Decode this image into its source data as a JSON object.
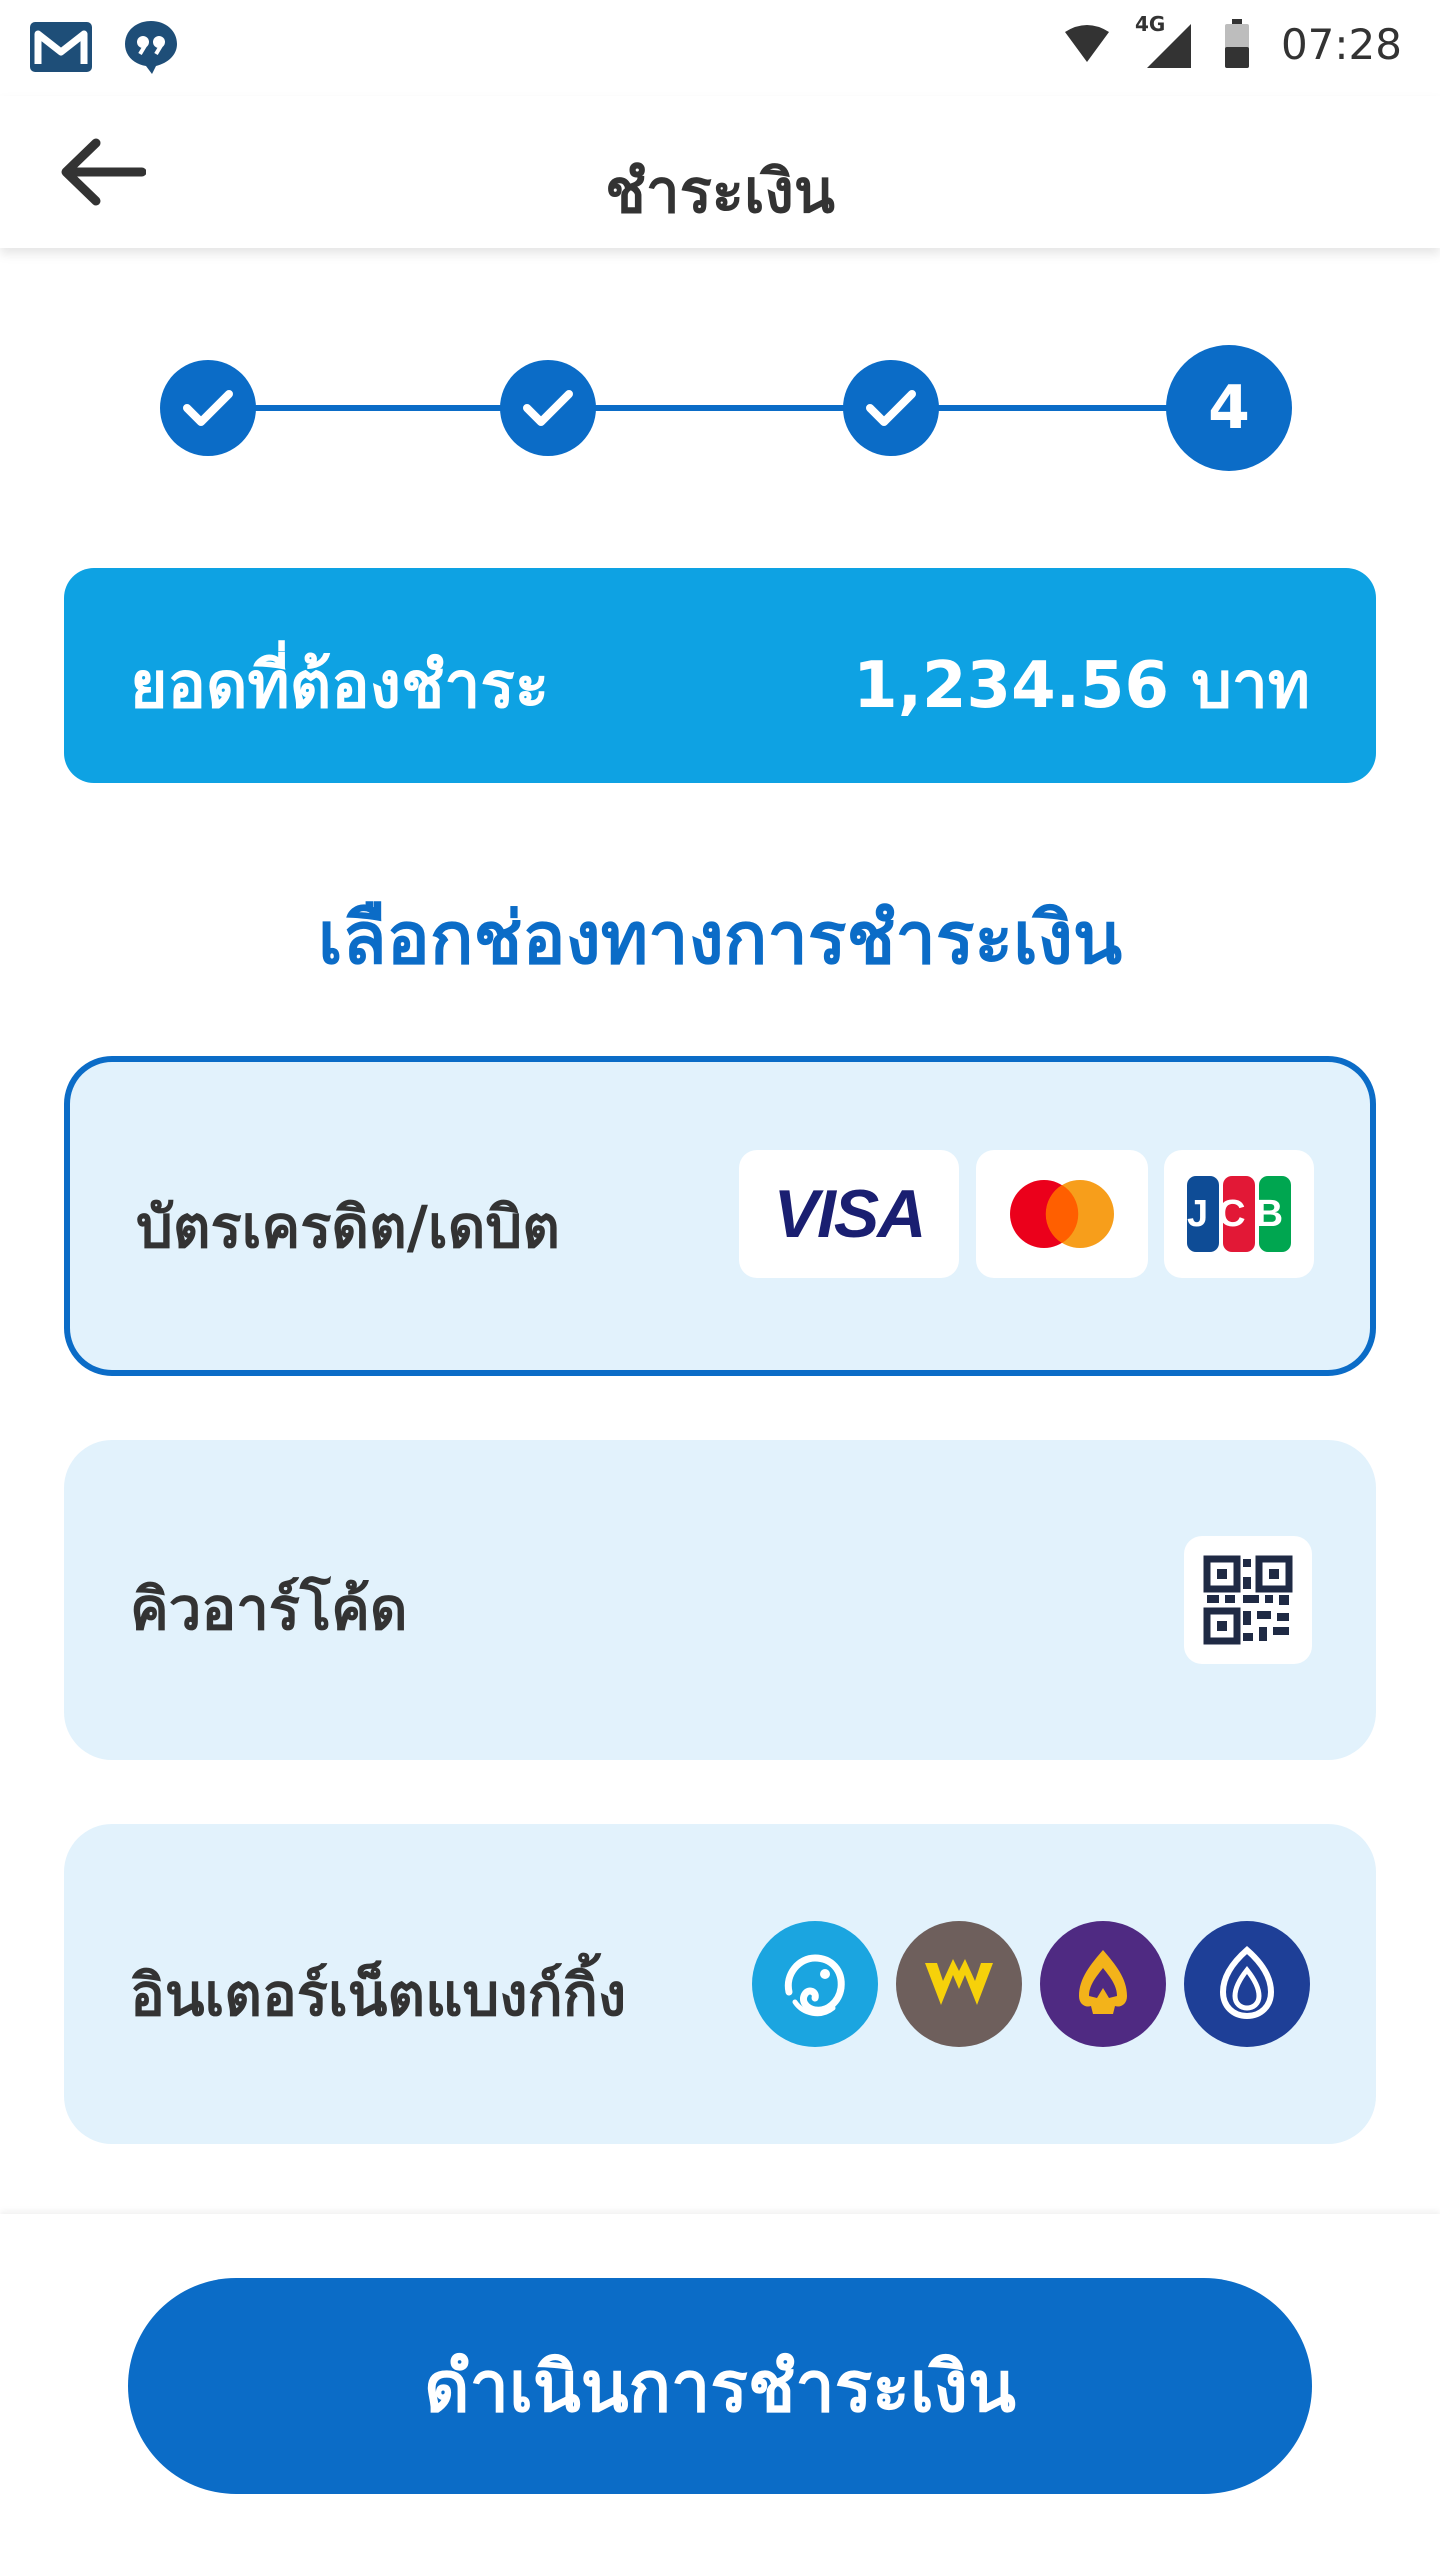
{
  "status_bar": {
    "time": "07:28",
    "network_label": "4G",
    "icons": [
      "gmail-icon",
      "quote-message-icon",
      "wifi-icon",
      "cell-signal-icon",
      "battery-icon"
    ]
  },
  "header": {
    "title": "ชำระเงิน",
    "back_icon": "arrow-left-icon"
  },
  "stepper": {
    "steps": [
      {
        "state": "completed",
        "icon": "check-icon"
      },
      {
        "state": "completed",
        "icon": "check-icon"
      },
      {
        "state": "completed",
        "icon": "check-icon"
      },
      {
        "state": "current",
        "label": "4"
      }
    ]
  },
  "amount": {
    "label": "ยอดที่ต้องชำระ",
    "value": "1,234.56 บาท"
  },
  "section_title": "เลือกช่องทางการชำระเงิน",
  "methods": [
    {
      "label": "บัตรเครดิต/เดบิต",
      "selected": true,
      "logos": [
        "visa-logo",
        "mastercard-logo",
        "jcb-logo"
      ],
      "visa_text": "VISA",
      "jcb_text": "JCB"
    },
    {
      "label": "คิวอาร์โค้ด",
      "selected": false,
      "logos": [
        "qr-code-icon"
      ]
    },
    {
      "label": "อินเตอร์เน็ตแบงก์กิ้ง",
      "selected": false,
      "logos": [
        "kasikorn-bank-logo",
        "krungsri-bank-logo",
        "scb-bank-logo",
        "bangkok-bank-logo"
      ]
    }
  ],
  "pay_button": {
    "label": "ดำเนินการชำระเงิน"
  },
  "colors": {
    "primary": "#0b6cc7",
    "amount_card": "#0ea2e3",
    "method_bg": "#e2f2fc",
    "text_dark": "#333333"
  }
}
